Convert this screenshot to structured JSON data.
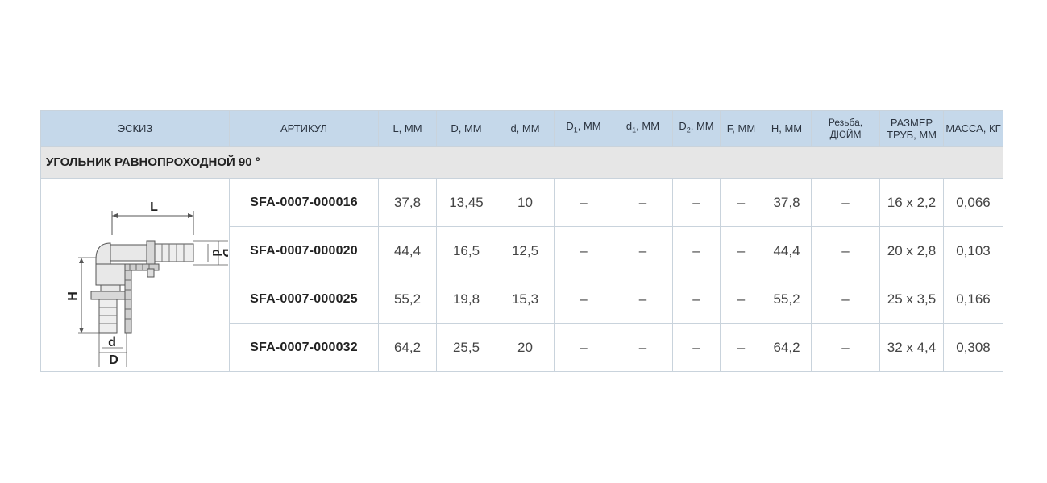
{
  "headers": {
    "sketch": "ЭСКИЗ",
    "article": "АРТИКУЛ",
    "L": "L, MM",
    "D": "D, MM",
    "d": "d, MM",
    "D1_base": "D",
    "D1_sub": "1",
    "D1_unit": ", MM",
    "d1_base": "d",
    "d1_sub": "1",
    "d1_unit": ", MM",
    "D2_base": "D",
    "D2_sub": "2",
    "D2_unit": ", MM",
    "F": "F, MM",
    "H": "H, MM",
    "thread_line1": "Резьба,",
    "thread_line2": "ДЮЙМ",
    "size_line1": "РАЗМЕР",
    "size_line2": "ТРУБ, ММ",
    "mass": "МАССА, КГ"
  },
  "section_title": "УГОЛЬНИК РАВНОПРОХОДНОЙ 90 °",
  "sketch_labels": {
    "L": "L",
    "H": "H",
    "d_side": "d",
    "D_side": "D",
    "d_bottom": "d",
    "D_bottom": "D"
  },
  "rows": [
    {
      "article": "SFA-0007-000016",
      "L": "37,8",
      "D": "13,45",
      "d": "10",
      "D1": "–",
      "d1": "–",
      "D2": "–",
      "F": "–",
      "H": "37,8",
      "thread": "–",
      "size": "16 x 2,2",
      "mass": "0,066"
    },
    {
      "article": "SFA-0007-000020",
      "L": "44,4",
      "D": "16,5",
      "d": "12,5",
      "D1": "–",
      "d1": "–",
      "D2": "–",
      "F": "–",
      "H": "44,4",
      "thread": "–",
      "size": "20 x 2,8",
      "mass": "0,103"
    },
    {
      "article": "SFA-0007-000025",
      "L": "55,2",
      "D": "19,8",
      "d": "15,3",
      "D1": "–",
      "d1": "–",
      "D2": "–",
      "F": "–",
      "H": "55,2",
      "thread": "–",
      "size": "25 x 3,5",
      "mass": "0,166"
    },
    {
      "article": "SFA-0007-000032",
      "L": "64,2",
      "D": "25,5",
      "d": "20",
      "D1": "–",
      "d1": "–",
      "D2": "–",
      "F": "–",
      "H": "64,2",
      "thread": "–",
      "size": "32 x 4,4",
      "mass": "0,308"
    }
  ]
}
